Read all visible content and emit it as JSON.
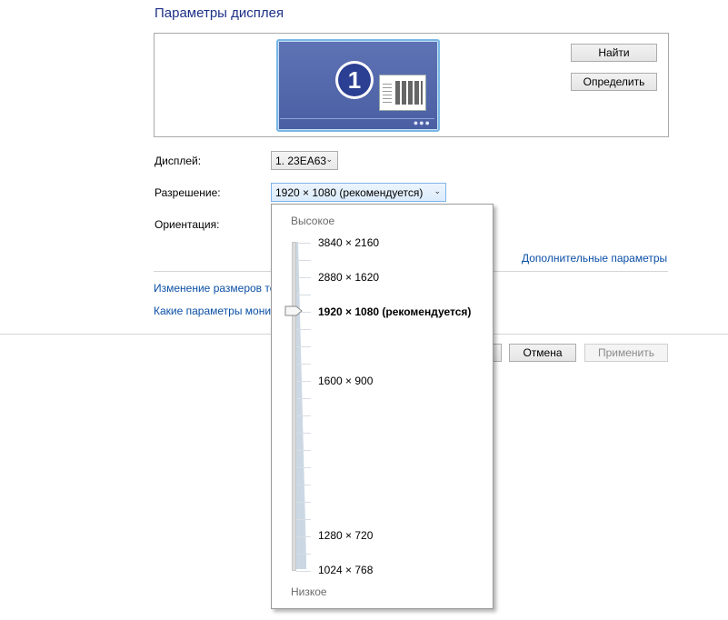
{
  "page": {
    "title": "Параметры дисплея"
  },
  "preview": {
    "monitor_number": "1",
    "find_label": "Найти",
    "identify_label": "Определить"
  },
  "form": {
    "display_label": "Дисплей:",
    "display_value": "1. 23EA63",
    "resolution_label": "Разрешение:",
    "resolution_value": "1920 × 1080 (рекомендуется)",
    "orientation_label": "Ориентация:"
  },
  "links": {
    "advanced": "Дополнительные параметры",
    "text_size": "Изменение размеров те",
    "monitor_settings": "Какие параметры мони"
  },
  "footer": {
    "cancel_label": "Отмена",
    "apply_label": "Применить"
  },
  "resolution_dropdown": {
    "high_label": "Высокое",
    "low_label": "Низкое",
    "options": [
      {
        "label": "3840 × 2160",
        "selected": false
      },
      {
        "label": "2880 × 1620",
        "selected": false
      },
      {
        "label": "1920 × 1080 (рекомендуется)",
        "selected": true
      },
      {
        "label": "1600 × 900",
        "selected": false
      },
      {
        "label": "1280 × 720",
        "selected": false
      },
      {
        "label": "1024 × 768",
        "selected": false
      }
    ]
  },
  "colors": {
    "title": "#1e3287",
    "link": "#0b4fa6",
    "monitor": "#4a5ea3",
    "monitor_border": "#79b8e6"
  }
}
